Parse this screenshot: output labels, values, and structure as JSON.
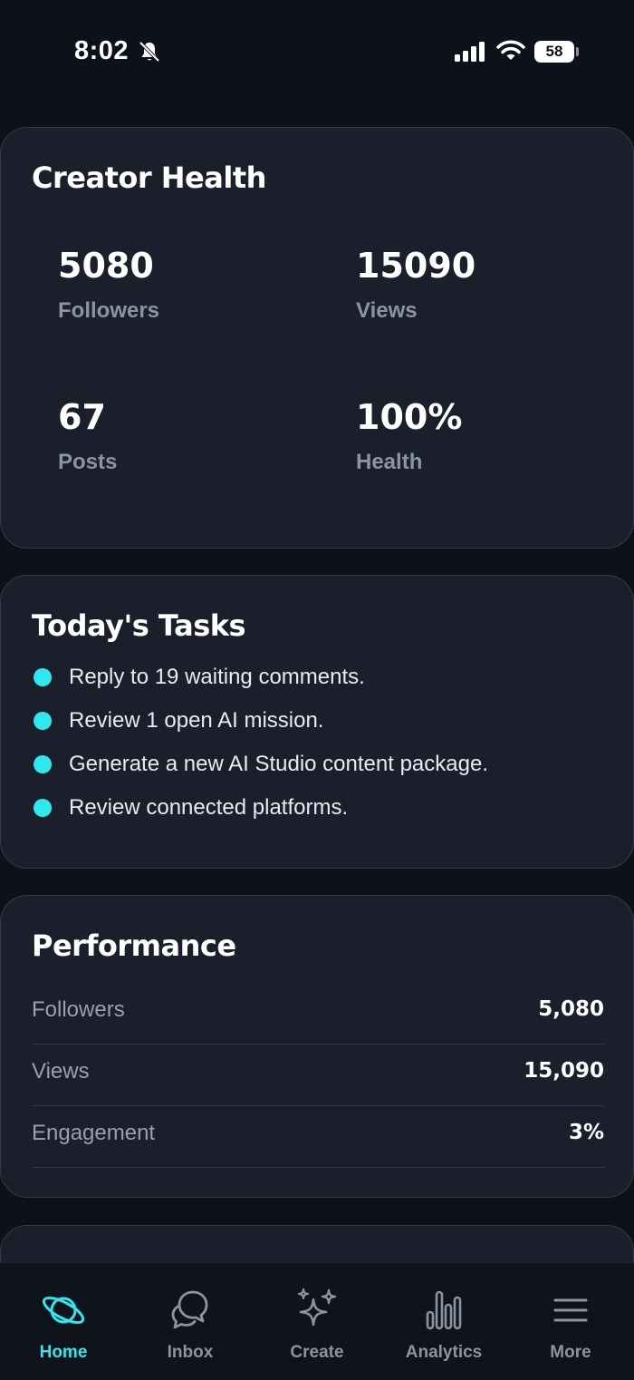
{
  "status_bar": {
    "time": "8:02",
    "battery": "58",
    "icons": [
      "bell-slash-icon",
      "cellular-signal-icon",
      "wifi-icon",
      "battery-icon"
    ]
  },
  "creator_health": {
    "title": "Creator Health",
    "stats": [
      {
        "value": "5080",
        "label": "Followers"
      },
      {
        "value": "15090",
        "label": "Views"
      },
      {
        "value": "67",
        "label": "Posts"
      },
      {
        "value": "100%",
        "label": "Health"
      }
    ]
  },
  "tasks": {
    "title": "Today's Tasks",
    "items": [
      "Reply to 19 waiting comments.",
      "Review 1 open AI mission.",
      "Generate a new AI Studio content package.",
      "Review connected platforms."
    ]
  },
  "performance": {
    "title": "Performance",
    "rows": [
      {
        "label": "Followers",
        "value": "5,080"
      },
      {
        "label": "Views",
        "value": "15,090"
      },
      {
        "label": "Engagement",
        "value": "3%"
      }
    ]
  },
  "nav": {
    "items": [
      {
        "label": "Home",
        "icon": "planet-icon",
        "active": true
      },
      {
        "label": "Inbox",
        "icon": "chat-bubbles-icon",
        "active": false
      },
      {
        "label": "Create",
        "icon": "sparkles-icon",
        "active": false
      },
      {
        "label": "Analytics",
        "icon": "bar-chart-icon",
        "active": false
      },
      {
        "label": "More",
        "icon": "menu-icon",
        "active": false
      }
    ]
  },
  "colors": {
    "background": "#0d1119",
    "card": "#1b1f2b",
    "accent": "#2ee8ee",
    "muted": "#8a94a6"
  }
}
